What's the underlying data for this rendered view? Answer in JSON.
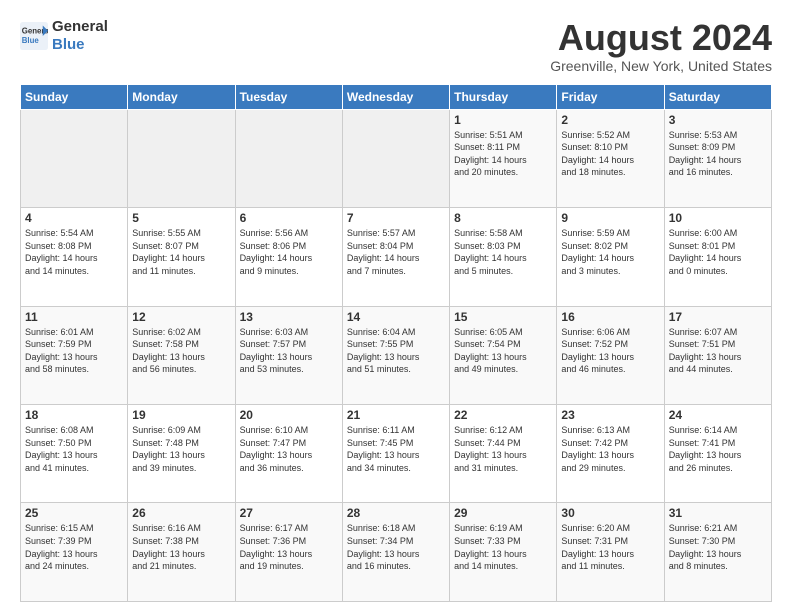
{
  "header": {
    "logo_line1": "General",
    "logo_line2": "Blue",
    "title": "August 2024",
    "subtitle": "Greenville, New York, United States"
  },
  "weekdays": [
    "Sunday",
    "Monday",
    "Tuesday",
    "Wednesday",
    "Thursday",
    "Friday",
    "Saturday"
  ],
  "weeks": [
    [
      {
        "day": "",
        "info": ""
      },
      {
        "day": "",
        "info": ""
      },
      {
        "day": "",
        "info": ""
      },
      {
        "day": "",
        "info": ""
      },
      {
        "day": "1",
        "info": "Sunrise: 5:51 AM\nSunset: 8:11 PM\nDaylight: 14 hours\nand 20 minutes."
      },
      {
        "day": "2",
        "info": "Sunrise: 5:52 AM\nSunset: 8:10 PM\nDaylight: 14 hours\nand 18 minutes."
      },
      {
        "day": "3",
        "info": "Sunrise: 5:53 AM\nSunset: 8:09 PM\nDaylight: 14 hours\nand 16 minutes."
      }
    ],
    [
      {
        "day": "4",
        "info": "Sunrise: 5:54 AM\nSunset: 8:08 PM\nDaylight: 14 hours\nand 14 minutes."
      },
      {
        "day": "5",
        "info": "Sunrise: 5:55 AM\nSunset: 8:07 PM\nDaylight: 14 hours\nand 11 minutes."
      },
      {
        "day": "6",
        "info": "Sunrise: 5:56 AM\nSunset: 8:06 PM\nDaylight: 14 hours\nand 9 minutes."
      },
      {
        "day": "7",
        "info": "Sunrise: 5:57 AM\nSunset: 8:04 PM\nDaylight: 14 hours\nand 7 minutes."
      },
      {
        "day": "8",
        "info": "Sunrise: 5:58 AM\nSunset: 8:03 PM\nDaylight: 14 hours\nand 5 minutes."
      },
      {
        "day": "9",
        "info": "Sunrise: 5:59 AM\nSunset: 8:02 PM\nDaylight: 14 hours\nand 3 minutes."
      },
      {
        "day": "10",
        "info": "Sunrise: 6:00 AM\nSunset: 8:01 PM\nDaylight: 14 hours\nand 0 minutes."
      }
    ],
    [
      {
        "day": "11",
        "info": "Sunrise: 6:01 AM\nSunset: 7:59 PM\nDaylight: 13 hours\nand 58 minutes."
      },
      {
        "day": "12",
        "info": "Sunrise: 6:02 AM\nSunset: 7:58 PM\nDaylight: 13 hours\nand 56 minutes."
      },
      {
        "day": "13",
        "info": "Sunrise: 6:03 AM\nSunset: 7:57 PM\nDaylight: 13 hours\nand 53 minutes."
      },
      {
        "day": "14",
        "info": "Sunrise: 6:04 AM\nSunset: 7:55 PM\nDaylight: 13 hours\nand 51 minutes."
      },
      {
        "day": "15",
        "info": "Sunrise: 6:05 AM\nSunset: 7:54 PM\nDaylight: 13 hours\nand 49 minutes."
      },
      {
        "day": "16",
        "info": "Sunrise: 6:06 AM\nSunset: 7:52 PM\nDaylight: 13 hours\nand 46 minutes."
      },
      {
        "day": "17",
        "info": "Sunrise: 6:07 AM\nSunset: 7:51 PM\nDaylight: 13 hours\nand 44 minutes."
      }
    ],
    [
      {
        "day": "18",
        "info": "Sunrise: 6:08 AM\nSunset: 7:50 PM\nDaylight: 13 hours\nand 41 minutes."
      },
      {
        "day": "19",
        "info": "Sunrise: 6:09 AM\nSunset: 7:48 PM\nDaylight: 13 hours\nand 39 minutes."
      },
      {
        "day": "20",
        "info": "Sunrise: 6:10 AM\nSunset: 7:47 PM\nDaylight: 13 hours\nand 36 minutes."
      },
      {
        "day": "21",
        "info": "Sunrise: 6:11 AM\nSunset: 7:45 PM\nDaylight: 13 hours\nand 34 minutes."
      },
      {
        "day": "22",
        "info": "Sunrise: 6:12 AM\nSunset: 7:44 PM\nDaylight: 13 hours\nand 31 minutes."
      },
      {
        "day": "23",
        "info": "Sunrise: 6:13 AM\nSunset: 7:42 PM\nDaylight: 13 hours\nand 29 minutes."
      },
      {
        "day": "24",
        "info": "Sunrise: 6:14 AM\nSunset: 7:41 PM\nDaylight: 13 hours\nand 26 minutes."
      }
    ],
    [
      {
        "day": "25",
        "info": "Sunrise: 6:15 AM\nSunset: 7:39 PM\nDaylight: 13 hours\nand 24 minutes."
      },
      {
        "day": "26",
        "info": "Sunrise: 6:16 AM\nSunset: 7:38 PM\nDaylight: 13 hours\nand 21 minutes."
      },
      {
        "day": "27",
        "info": "Sunrise: 6:17 AM\nSunset: 7:36 PM\nDaylight: 13 hours\nand 19 minutes."
      },
      {
        "day": "28",
        "info": "Sunrise: 6:18 AM\nSunset: 7:34 PM\nDaylight: 13 hours\nand 16 minutes."
      },
      {
        "day": "29",
        "info": "Sunrise: 6:19 AM\nSunset: 7:33 PM\nDaylight: 13 hours\nand 14 minutes."
      },
      {
        "day": "30",
        "info": "Sunrise: 6:20 AM\nSunset: 7:31 PM\nDaylight: 13 hours\nand 11 minutes."
      },
      {
        "day": "31",
        "info": "Sunrise: 6:21 AM\nSunset: 7:30 PM\nDaylight: 13 hours\nand 8 minutes."
      }
    ]
  ]
}
